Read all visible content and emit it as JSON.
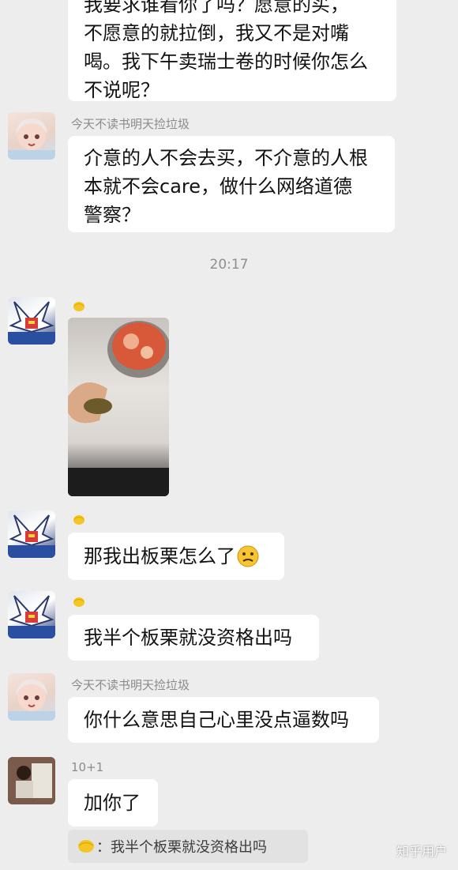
{
  "messages": {
    "m1": {
      "lines": [
        "我要求谁看你了吗？愿意的买，",
        "不愿意的就拉倒，我又不是对嘴",
        "喝。我下午卖瑞士卷的时候你怎么",
        "不说呢？"
      ]
    },
    "m2": {
      "sender": "今天不读书明天捡垃圾",
      "lines": [
        "介意的人不会去买，不介意的人根",
        "本就不会care，做什么网络道德",
        "警察？"
      ]
    },
    "time": "20:17",
    "m4": {
      "text": "那我出板栗怎么了"
    },
    "m5": {
      "text": "我半个板栗就没资格出吗"
    },
    "m6": {
      "sender": "今天不读书明天捡垃圾",
      "text": "你什么意思自己心里没点逼数吗"
    },
    "m7": {
      "sender": "10+1",
      "text": "加你了"
    },
    "quote": {
      "text": "：我半个板栗就没资格出吗"
    }
  },
  "watermark": "知乎用户",
  "icons": {
    "lemon": "lemon-icon",
    "emoji": "confused-face-emoji-icon"
  },
  "colors": {
    "background": "#ededed",
    "bubble": "#ffffff",
    "name": "#8b8b8b",
    "lemon": "#f3c623"
  }
}
